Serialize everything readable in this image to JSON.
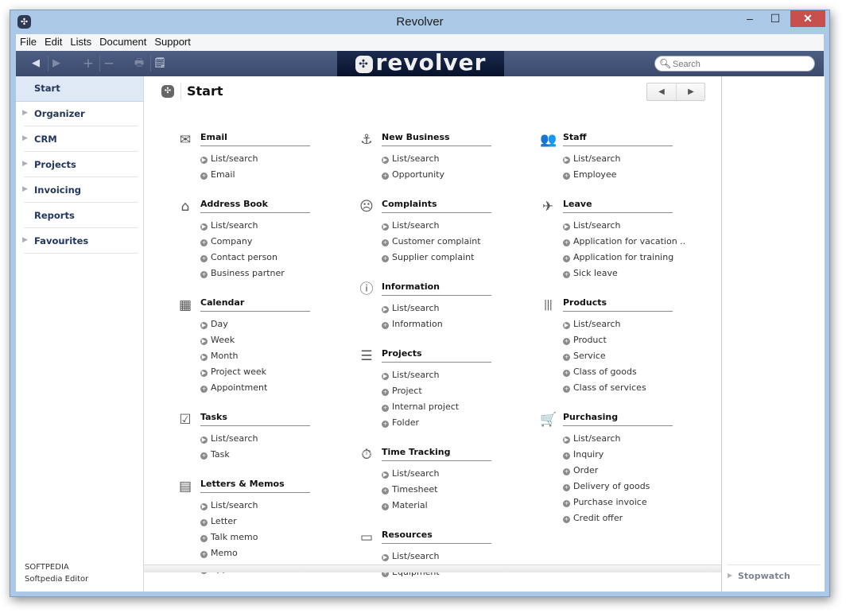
{
  "window": {
    "title": "Revolver",
    "controls": {
      "minimize": "–",
      "maximize": "☐",
      "close": "✕"
    }
  },
  "menu": [
    "File",
    "Edit",
    "Lists",
    "Document",
    "Support"
  ],
  "toolbar": {
    "back": "◀",
    "forward": "▶",
    "add": "+",
    "remove": "−",
    "print": "🖶",
    "note": "🗒",
    "logo_text": "revolver",
    "search_placeholder": "Search",
    "search_icon": "magnifier"
  },
  "sidebar": {
    "items": [
      {
        "label": "Start",
        "expandable": false,
        "active": true
      },
      {
        "label": "Organizer",
        "expandable": true
      },
      {
        "label": "CRM",
        "expandable": true
      },
      {
        "label": "Projects",
        "expandable": true
      },
      {
        "label": "Invoicing",
        "expandable": true
      },
      {
        "label": "Reports",
        "expandable": false
      },
      {
        "label": "Favourites",
        "expandable": true
      }
    ],
    "footer": {
      "company": "SOFTPEDIA",
      "user": "Softpedia Editor"
    }
  },
  "main": {
    "title": "Start",
    "pager": {
      "prev": "◀",
      "next": "▶"
    },
    "columns": [
      [
        {
          "title": "Email",
          "icon": "envelope-icon",
          "items": [
            {
              "label": "List/search",
              "kind": "list"
            },
            {
              "label": "Email",
              "kind": "add"
            }
          ]
        },
        {
          "title": "Address Book",
          "icon": "house-icon",
          "items": [
            {
              "label": "List/search",
              "kind": "list"
            },
            {
              "label": "Company",
              "kind": "add"
            },
            {
              "label": "Contact person",
              "kind": "add"
            },
            {
              "label": "Business partner",
              "kind": "add"
            }
          ]
        },
        {
          "title": "Calendar",
          "icon": "calendar-icon",
          "items": [
            {
              "label": "Day",
              "kind": "list"
            },
            {
              "label": "Week",
              "kind": "list"
            },
            {
              "label": "Month",
              "kind": "list"
            },
            {
              "label": "Project week",
              "kind": "list"
            },
            {
              "label": "Appointment",
              "kind": "add"
            }
          ]
        },
        {
          "title": "Tasks",
          "icon": "checkbox-icon",
          "items": [
            {
              "label": "List/search",
              "kind": "list"
            },
            {
              "label": "Task",
              "kind": "add"
            }
          ]
        },
        {
          "title": "Letters & Memos",
          "icon": "letter-icon",
          "items": [
            {
              "label": "List/search",
              "kind": "list"
            },
            {
              "label": "Letter",
              "kind": "add"
            },
            {
              "label": "Talk memo",
              "kind": "add"
            },
            {
              "label": "Memo",
              "kind": "add"
            },
            {
              "label": "Appointment",
              "kind": "add"
            }
          ]
        }
      ],
      [
        {
          "title": "New Business",
          "icon": "anchor-icon",
          "items": [
            {
              "label": "List/search",
              "kind": "list"
            },
            {
              "label": "Opportunity",
              "kind": "add"
            }
          ]
        },
        {
          "title": "Complaints",
          "icon": "sad-face-icon",
          "items": [
            {
              "label": "List/search",
              "kind": "list"
            },
            {
              "label": "Customer complaint",
              "kind": "add"
            },
            {
              "label": "Supplier complaint",
              "kind": "add"
            }
          ]
        },
        {
          "title": "Information",
          "icon": "info-icon",
          "items": [
            {
              "label": "List/search",
              "kind": "list"
            },
            {
              "label": "Information",
              "kind": "add"
            }
          ]
        },
        {
          "title": "Projects",
          "icon": "gantt-icon",
          "items": [
            {
              "label": "List/search",
              "kind": "list"
            },
            {
              "label": "Project",
              "kind": "add"
            },
            {
              "label": "Internal project",
              "kind": "add"
            },
            {
              "label": "Folder",
              "kind": "add"
            }
          ]
        },
        {
          "title": "Time Tracking",
          "icon": "stopwatch-icon",
          "items": [
            {
              "label": "List/search",
              "kind": "list"
            },
            {
              "label": "Timesheet",
              "kind": "add"
            },
            {
              "label": "Material",
              "kind": "add"
            }
          ]
        },
        {
          "title": "Resources",
          "icon": "monitor-icon",
          "items": [
            {
              "label": "List/search",
              "kind": "list"
            },
            {
              "label": "Equipment",
              "kind": "add"
            }
          ]
        }
      ],
      [
        {
          "title": "Staff",
          "icon": "people-icon",
          "items": [
            {
              "label": "List/search",
              "kind": "list"
            },
            {
              "label": "Employee",
              "kind": "add"
            }
          ]
        },
        {
          "title": "Leave",
          "icon": "airplane-icon",
          "items": [
            {
              "label": "List/search",
              "kind": "list"
            },
            {
              "label": "Application for vacation ..",
              "kind": "add"
            },
            {
              "label": "Application for training",
              "kind": "add"
            },
            {
              "label": "Sick leave",
              "kind": "add"
            }
          ]
        },
        {
          "title": "Products",
          "icon": "barcode-icon",
          "items": [
            {
              "label": "List/search",
              "kind": "list"
            },
            {
              "label": "Product",
              "kind": "add"
            },
            {
              "label": "Service",
              "kind": "add"
            },
            {
              "label": "Class of goods",
              "kind": "add"
            },
            {
              "label": "Class of services",
              "kind": "add"
            }
          ]
        },
        {
          "title": "Purchasing",
          "icon": "cart-icon",
          "items": [
            {
              "label": "List/search",
              "kind": "list"
            },
            {
              "label": "Inquiry",
              "kind": "add"
            },
            {
              "label": "Order",
              "kind": "add"
            },
            {
              "label": "Delivery of goods",
              "kind": "add"
            },
            {
              "label": "Purchase invoice",
              "kind": "add"
            },
            {
              "label": "Credit offer",
              "kind": "add"
            }
          ]
        }
      ]
    ]
  },
  "right_panel": {
    "stopwatch_label": "Stopwatch"
  }
}
